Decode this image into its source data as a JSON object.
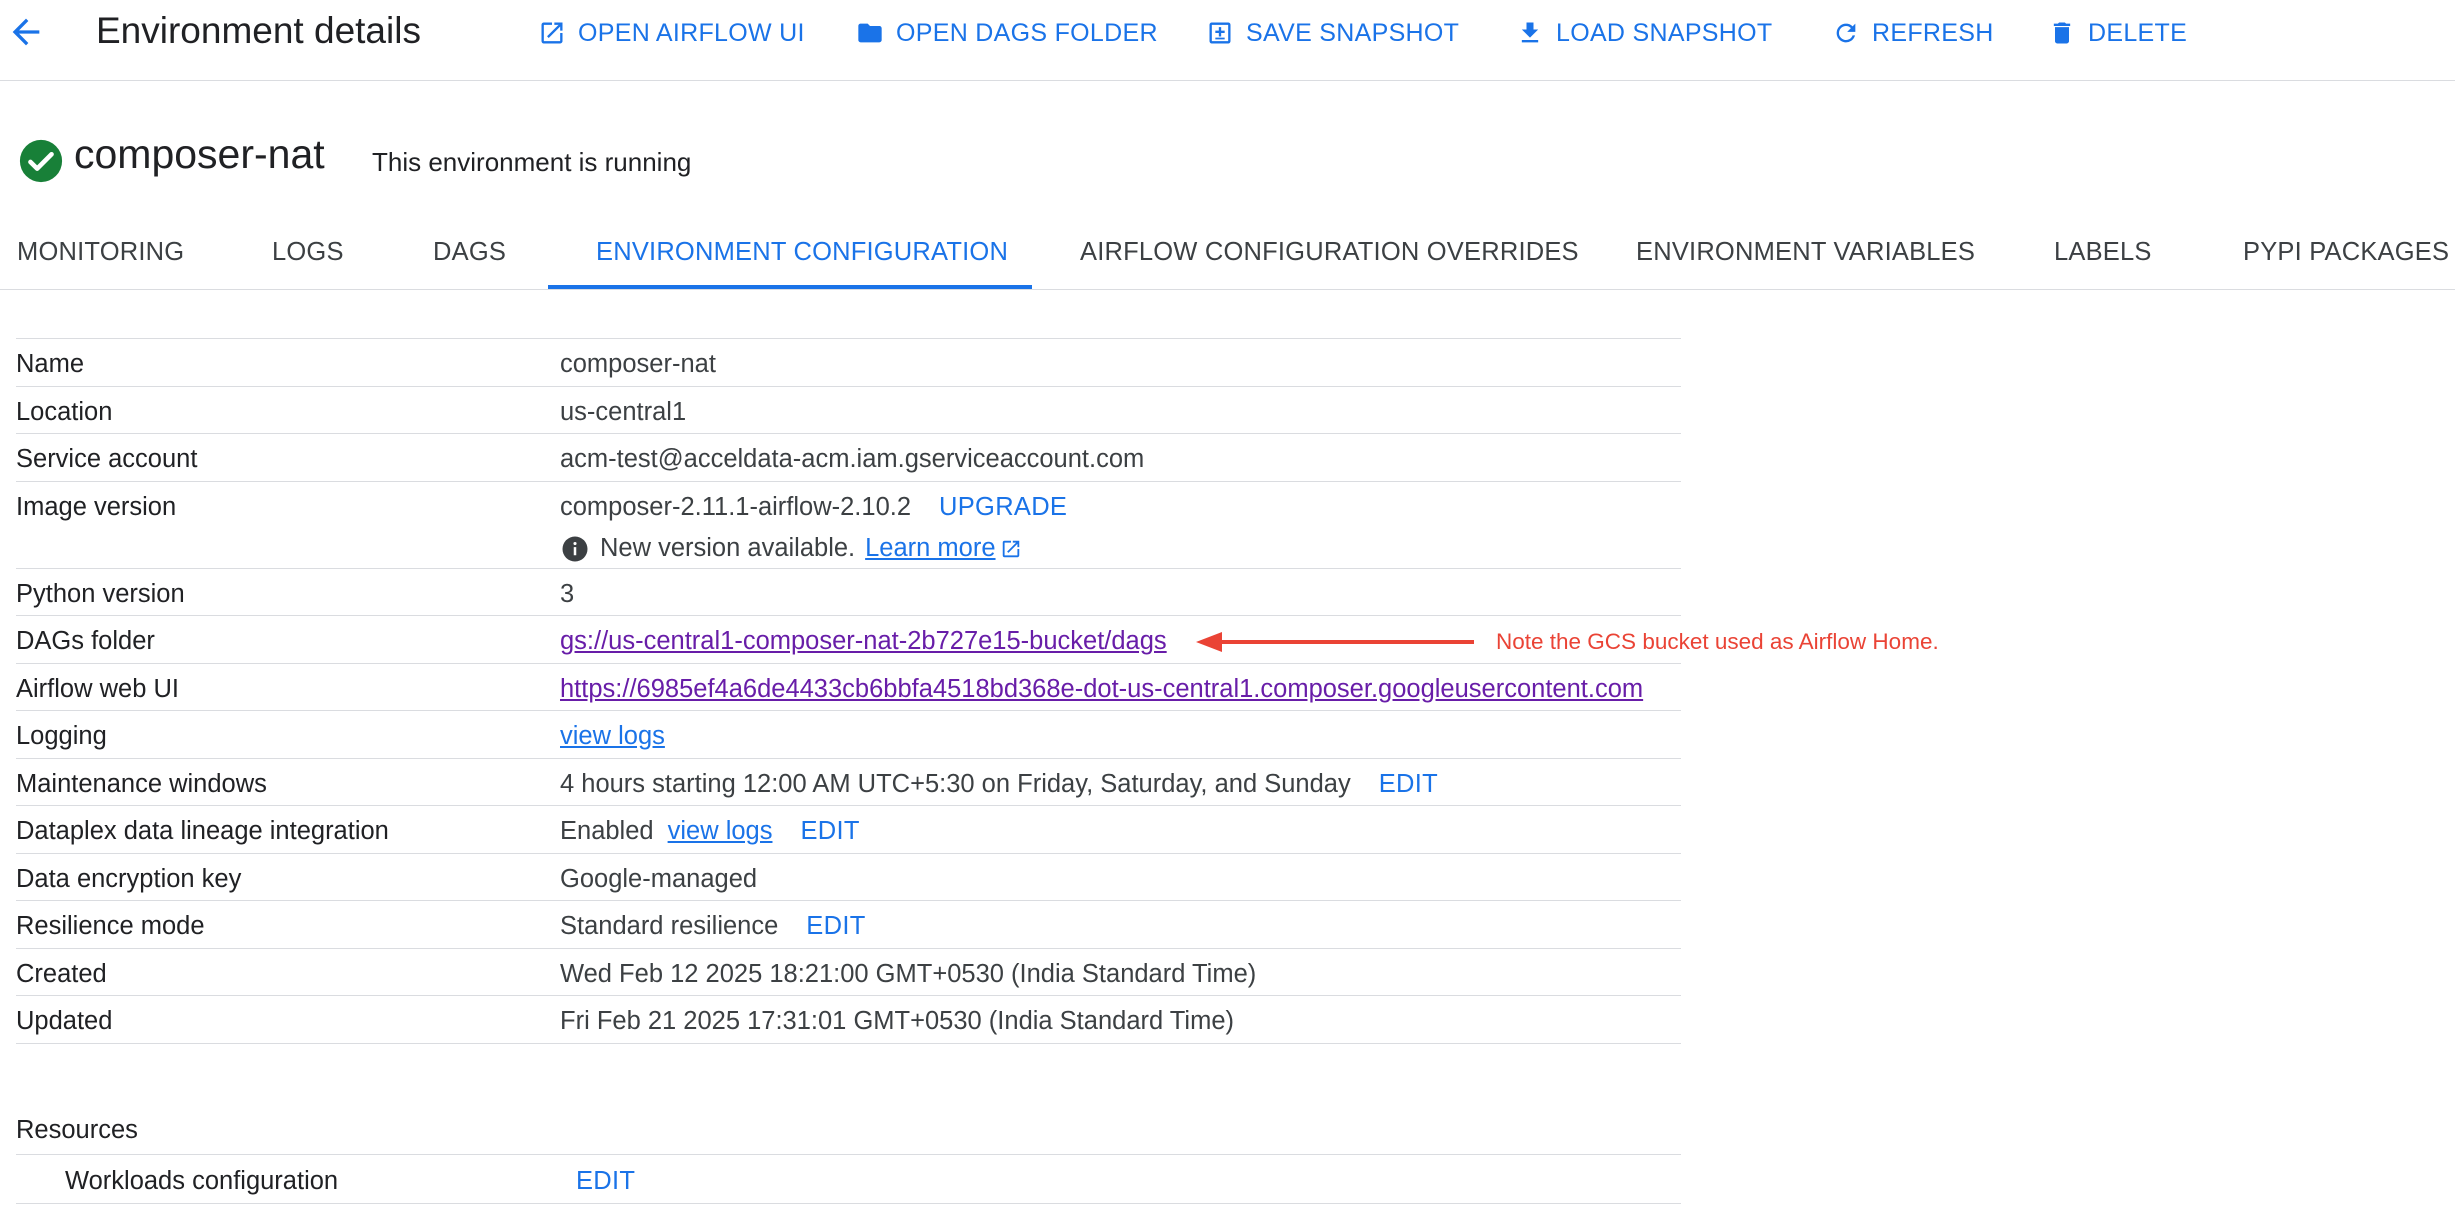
{
  "header": {
    "title": "Environment details",
    "actions": [
      {
        "label": "OPEN AIRFLOW UI",
        "icon": "open-in-new-icon"
      },
      {
        "label": "OPEN DAGS FOLDER",
        "icon": "folder-icon"
      },
      {
        "label": "SAVE SNAPSHOT",
        "icon": "save-snapshot-icon"
      },
      {
        "label": "LOAD SNAPSHOT",
        "icon": "download-icon"
      },
      {
        "label": "REFRESH",
        "icon": "refresh-icon"
      },
      {
        "label": "DELETE",
        "icon": "delete-icon"
      }
    ]
  },
  "environment": {
    "name": "composer-nat",
    "status": "This environment is running"
  },
  "tabs": [
    {
      "label": "MONITORING"
    },
    {
      "label": "LOGS"
    },
    {
      "label": "DAGS"
    },
    {
      "label": "ENVIRONMENT CONFIGURATION",
      "active": true
    },
    {
      "label": "AIRFLOW CONFIGURATION OVERRIDES"
    },
    {
      "label": "ENVIRONMENT VARIABLES"
    },
    {
      "label": "LABELS"
    },
    {
      "label": "PYPI PACKAGES"
    }
  ],
  "config": {
    "name": {
      "label": "Name",
      "value": "composer-nat"
    },
    "location": {
      "label": "Location",
      "value": "us-central1"
    },
    "service_account": {
      "label": "Service account",
      "value": "acm-test@acceldata-acm.iam.gserviceaccount.com"
    },
    "image_version": {
      "label": "Image version",
      "value": "composer-2.11.1-airflow-2.10.2",
      "action": "UPGRADE",
      "notice": "New version available.",
      "notice_link": "Learn more"
    },
    "python_version": {
      "label": "Python version",
      "value": "3"
    },
    "dags_folder": {
      "label": "DAGs folder",
      "value": "gs://us-central1-composer-nat-2b727e15-bucket/dags"
    },
    "airflow_web_ui": {
      "label": "Airflow web UI",
      "value": "https://6985ef4a6de4433cb6bbfa4518bd368e-dot-us-central1.composer.googleusercontent.com"
    },
    "logging": {
      "label": "Logging",
      "value": "view logs"
    },
    "maintenance": {
      "label": "Maintenance windows",
      "value": "4 hours starting 12:00 AM UTC+5:30 on Friday, Saturday, and Sunday",
      "action": "EDIT"
    },
    "dataplex": {
      "label": "Dataplex data lineage integration",
      "value": "Enabled",
      "link": "view logs",
      "action": "EDIT"
    },
    "encryption": {
      "label": "Data encryption key",
      "value": "Google-managed"
    },
    "resilience": {
      "label": "Resilience mode",
      "value": "Standard resilience",
      "action": "EDIT"
    },
    "created": {
      "label": "Created",
      "value": "Wed Feb 12 2025 18:21:00 GMT+0530 (India Standard Time)"
    },
    "updated": {
      "label": "Updated",
      "value": "Fri Feb 21 2025 17:31:01 GMT+0530 (India Standard Time)"
    }
  },
  "annotation": {
    "text": "Note the GCS bucket used as Airflow Home.",
    "color": "#ea4335"
  },
  "resources": {
    "title": "Resources",
    "workloads": {
      "label": "Workloads configuration",
      "action": "EDIT"
    }
  },
  "colors": {
    "accent": "#1a73e8",
    "visited_link": "#681da8",
    "success": "#188038",
    "divider": "#dadce0"
  }
}
